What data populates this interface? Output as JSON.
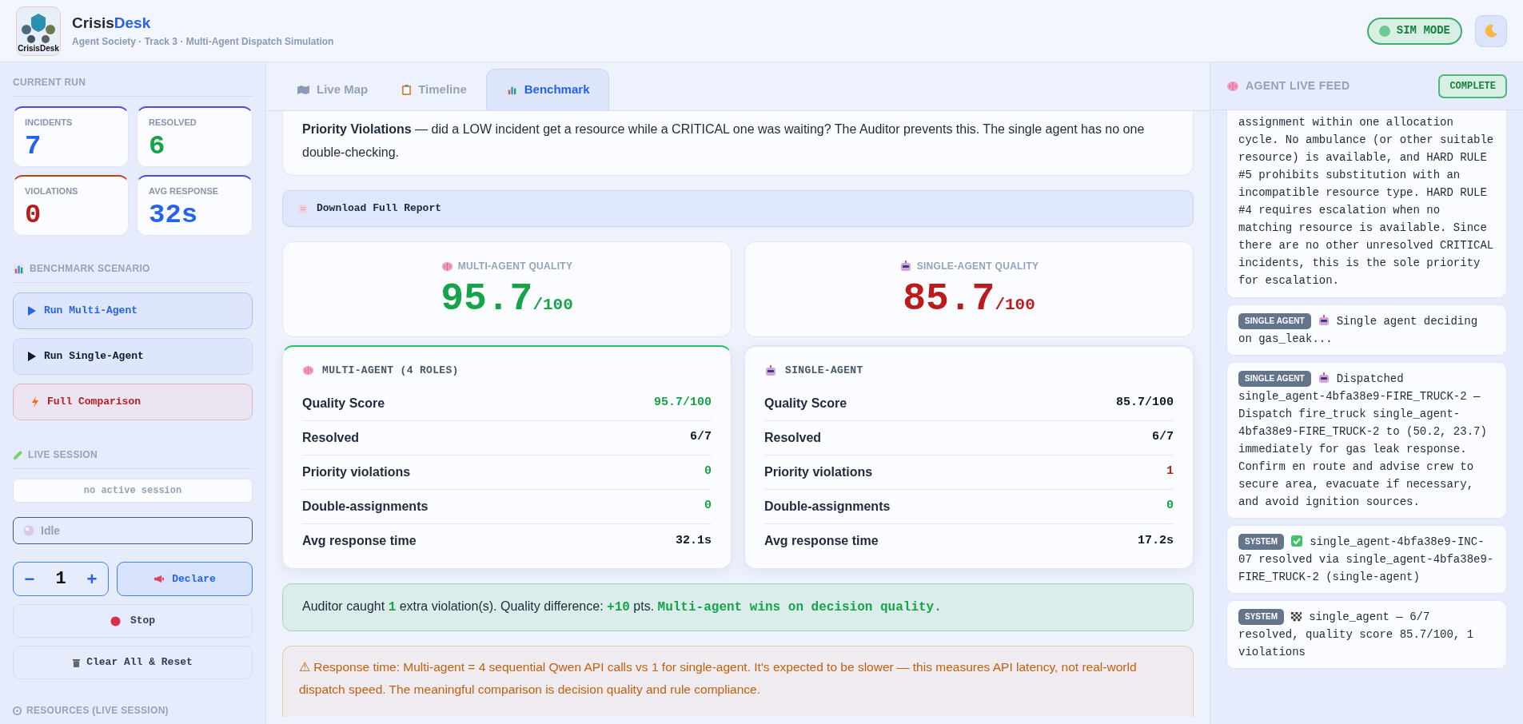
{
  "header": {
    "logo_caption": "CrisisDesk",
    "title_parts": [
      "Crisis",
      "Desk"
    ],
    "subtitle": "Agent Society · Track 3 · Multi-Agent Dispatch Simulation",
    "mode_badge": "SIM MODE"
  },
  "sidebar": {
    "current_run": {
      "title": "CURRENT RUN",
      "stats": [
        {
          "label": "INCIDENTS",
          "value": "7",
          "color": "#2563eb"
        },
        {
          "label": "RESOLVED",
          "value": "6",
          "color": "#16a34a"
        },
        {
          "label": "VIOLATIONS",
          "value": "0",
          "color": "#b91c1c"
        },
        {
          "label": "AVG RESPONSE",
          "value": "32s",
          "color": "#2563eb"
        }
      ]
    },
    "benchmark": {
      "title": "BENCHMARK SCENARIO",
      "buttons": [
        {
          "label": "Run Multi-Agent",
          "kind": "primary"
        },
        {
          "label": "Run Single-Agent",
          "kind": "secondary"
        },
        {
          "label": "Full Comparison",
          "kind": "danger"
        }
      ]
    },
    "live_session": {
      "title": "LIVE SESSION",
      "session": "no active session",
      "status": "Idle",
      "minus": "−",
      "count": "1",
      "plus": "+",
      "declare": "Declare",
      "stop": "Stop",
      "clear": "Clear All & Reset"
    },
    "resources_title": "RESOURCES (LIVE SESSION)"
  },
  "tabs": [
    {
      "label": "Live Map",
      "kind": "map",
      "selected": false
    },
    {
      "label": "Timeline",
      "kind": "clipboard",
      "selected": false
    },
    {
      "label": "Benchmark",
      "kind": "chart",
      "selected": true
    }
  ],
  "intro": "**Priority Violations** — did a LOW incident get a resource while a CRITICAL one was waiting? The Auditor prevents this. The single agent has no one double-checking.",
  "download": "Download Full Report",
  "quality": [
    {
      "label": "MULTI-AGENT QUALITY",
      "kind": "multi",
      "score": "95.7",
      "max": "/100",
      "color": "#16a34a"
    },
    {
      "label": "SINGLE-AGENT QUALITY",
      "kind": "single",
      "score": "85.7",
      "max": "/100",
      "color": "#b91c1c"
    }
  ],
  "comparison": [
    {
      "title": "MULTI-AGENT (4 ROLES)",
      "kind": "multi",
      "winner": true,
      "rows": [
        {
          "label": "Quality Score",
          "value": "95.7/100",
          "color": "#16a34a"
        },
        {
          "label": "Resolved",
          "value": "6/7",
          "color": "#111827"
        },
        {
          "label": "Priority violations",
          "value": "0",
          "color": "#16a34a"
        },
        {
          "label": "Double-assignments",
          "value": "0",
          "color": "#16a34a"
        },
        {
          "label": "Avg response time",
          "value": "32.1s",
          "color": "#111827"
        }
      ]
    },
    {
      "title": "SINGLE-AGENT",
      "kind": "single",
      "winner": false,
      "rows": [
        {
          "label": "Quality Score",
          "value": "85.7/100",
          "color": "#111827"
        },
        {
          "label": "Resolved",
          "value": "6/7",
          "color": "#111827"
        },
        {
          "label": "Priority violations",
          "value": "1",
          "color": "#b91c1c"
        },
        {
          "label": "Double-assignments",
          "value": "0",
          "color": "#16a34a"
        },
        {
          "label": "Avg response time",
          "value": "17.2s",
          "color": "#111827"
        }
      ]
    }
  ],
  "summary": "Auditor caught **1** extra violation(s). Quality difference: **+10** pts. **Multi-agent wins on decision quality.**",
  "note": "⚠ Response time: Multi-agent = 4 sequential Qwen API calls vs 1 for single-agent. It's expected to be slower — this measures API latency, not real-world dispatch speed. The meaningful comparison is decision quality and rule compliance.",
  "feed": {
    "title": "AGENT LIVE FEED",
    "status": "COMPLETE",
    "entries": [
      {
        "kind": "reasoning",
        "text": "assignment within one allocation cycle. No ambulance (or other suitable resource) is available, and HARD RULE #5 prohibits substitution with an incompatible resource type. HARD RULE #4 requires escalation when no matching resource is available. Since there are no other unresolved CRITICAL incidents, this is the sole priority for escalation."
      },
      {
        "kind": "agent",
        "tag": "SINGLE AGENT",
        "text": "Single agent deciding on gas_leak..."
      },
      {
        "kind": "agent",
        "tag": "SINGLE AGENT",
        "text": "Dispatched single_agent-4bfa38e9-FIRE_TRUCK-2 — Dispatch fire_truck single_agent-4bfa38e9-FIRE_TRUCK-2 to (50.2, 23.7) immediately for gas leak response. Confirm en route and advise crew to secure area, evacuate if necessary, and avoid ignition sources."
      },
      {
        "kind": "resolved",
        "tag": "SYSTEM",
        "text": "single_agent-4bfa38e9-INC-07 resolved via single_agent-4bfa38e9-FIRE_TRUCK-2 (single-agent)"
      },
      {
        "kind": "summary",
        "tag": "SYSTEM",
        "text": "single_agent — 6/7 resolved, quality score 85.7/100, 1 violations"
      }
    ]
  }
}
